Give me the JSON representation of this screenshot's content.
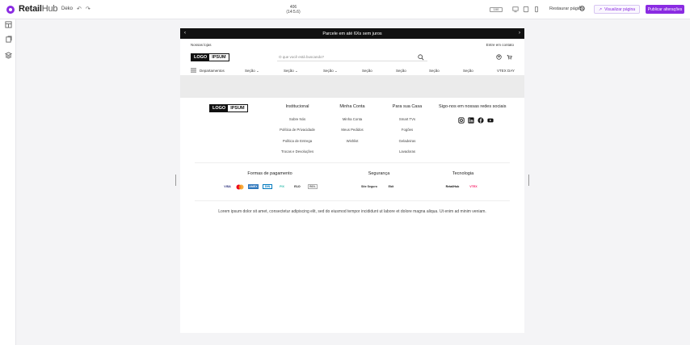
{
  "topbar": {
    "brand_bold": "Retail",
    "brand_light": "Hub",
    "doc_name": "Deko",
    "size_line1": "406",
    "size_line2": "(14:5.6)",
    "zoom": "100",
    "restore_label": "Restaurar página",
    "preview_label": "Visualizar página",
    "publish_label": "Publicar alterações",
    "accent_color": "#8a2be2"
  },
  "rail": {
    "icons": [
      "layout-icon",
      "pages-icon",
      "components-icon"
    ]
  },
  "store": {
    "promo": "Parcele em até 6Xs sem juros",
    "util_left": "Nossas lojas",
    "util_right": "Entre em contato",
    "logo_a": "LOGO",
    "logo_b": "IPSUM",
    "search_placeholder": "O que você está buscando?",
    "nav": {
      "departments": "Departamentos",
      "items": [
        "Seção",
        "Seção",
        "Seção",
        "Seção",
        "Seção",
        "Seção",
        "Seção"
      ],
      "vtex_day": "VTEX DAY"
    },
    "footer": {
      "col1": {
        "title": "Institucional",
        "links": [
          "Sobre Nós",
          "Política de Privacidade",
          "Política de Entrega",
          "Trocas e Devoluções"
        ]
      },
      "col2": {
        "title": "Minha Conta",
        "links": [
          "Minha Conta",
          "Meus Pedidos",
          "Wishlist"
        ]
      },
      "col3": {
        "title": "Para sua Casa",
        "links": [
          "Smart TVs",
          "Fogões",
          "Geladeiras",
          "Lavadoras"
        ]
      },
      "social_title": "Sigo-nos em nossas redes sociais",
      "payment_title": "Formas de pagamento",
      "security_title": "Segurança",
      "tech_title": "Tecnologia",
      "payment_badges": [
        "VISA",
        "MC",
        "AMEX",
        "DIN",
        "PIX",
        "ELO",
        "BOL"
      ],
      "security_badges": [
        "Site Seguro",
        "Ebit"
      ],
      "tech_badges": [
        "RetailHub",
        "VTEX"
      ],
      "legal": "Lorem ipsum dolor sit amet, consectetur adipiscing elit, sed do eiusmod tempor incididunt ut labore et dolore magna aliqua. Ut enim ad minim veniam."
    }
  }
}
